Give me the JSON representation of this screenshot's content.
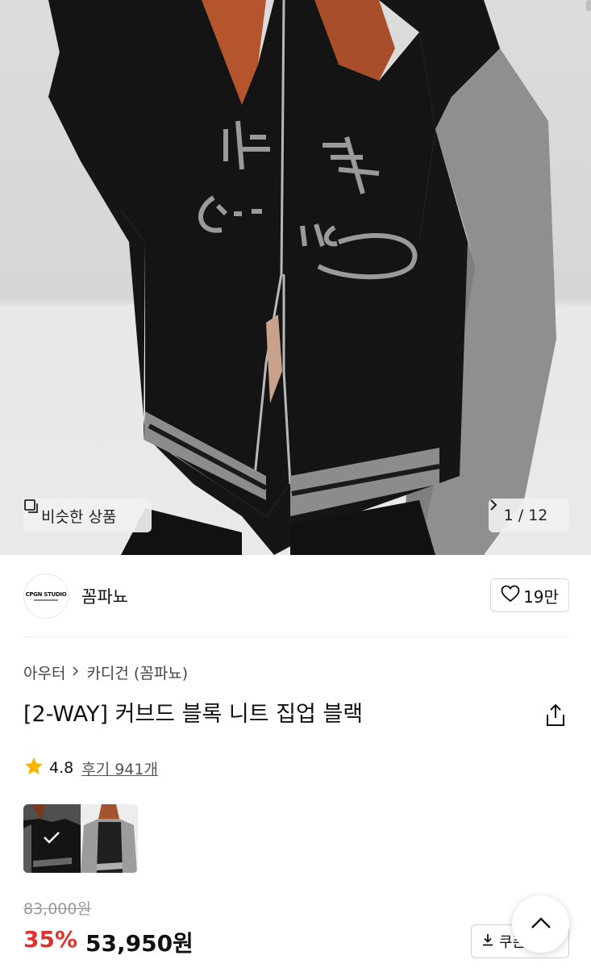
{
  "gallery": {
    "similar_label": "비슷한 상품",
    "counter": "1 / 12",
    "icons": {
      "similar": "similar-items-icon",
      "next": "chevron-right-icon"
    }
  },
  "brand": {
    "logo_text": "CPGN STUDIO",
    "name": "꼼파뇨",
    "likes": "19만",
    "icons": {
      "like": "heart-icon"
    }
  },
  "product": {
    "breadcrumb": [
      "아우터",
      "카디건 (꼼파뇨)"
    ],
    "title": "[2-WAY] 커브드 블록 니트 집업 블랙",
    "rating": "4.8",
    "reviews": "후기 941개",
    "original_price": "83,000원",
    "discount": "35%",
    "price": "53,950원",
    "colors": {
      "discount": "#e0312e",
      "star": "#f7b500"
    }
  },
  "actions": {
    "coupon_label": "쿠폰",
    "icons": {
      "share": "share-icon",
      "coupon": "download-icon",
      "top": "chevron-up-icon"
    }
  }
}
